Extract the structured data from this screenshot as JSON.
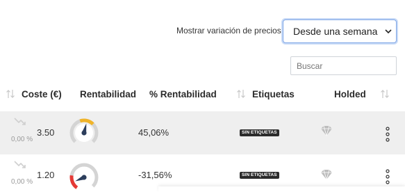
{
  "filter": {
    "label": "Mostrar variación de precios",
    "selected": "Desde una semana"
  },
  "search": {
    "placeholder": "Buscar"
  },
  "table": {
    "columns": [
      "Coste (€)",
      "Rentabilidad",
      "% Rentabilidad",
      "Etiquetas",
      "Holded"
    ],
    "rows": [
      {
        "trend_pct": "0,00 %",
        "cost": "3.50",
        "rentabilidad_pct": "45,06%",
        "tag": "SIN ETIQUETAS",
        "gauge_level": 0.55,
        "gauge_color": "#f0b429"
      },
      {
        "trend_pct": "0,00 %",
        "cost": "1.20",
        "rentabilidad_pct": "-31,56%",
        "tag": "SIN ETIQUETAS",
        "gauge_level": 0.08,
        "gauge_color": "#e53935"
      }
    ]
  },
  "icons": {
    "sort": "sort-arrows-icon",
    "trend": "trend-down-icon",
    "holded": "holded-diamond-icon",
    "menu": "kebab-menu-icon",
    "select": "chevron-down-icon"
  },
  "colors": {
    "select_border": "#7fa6e6",
    "row_stripe": "#efefef",
    "badge_bg": "#2b2b2b",
    "gauge_needle": "#2c3e5c"
  }
}
